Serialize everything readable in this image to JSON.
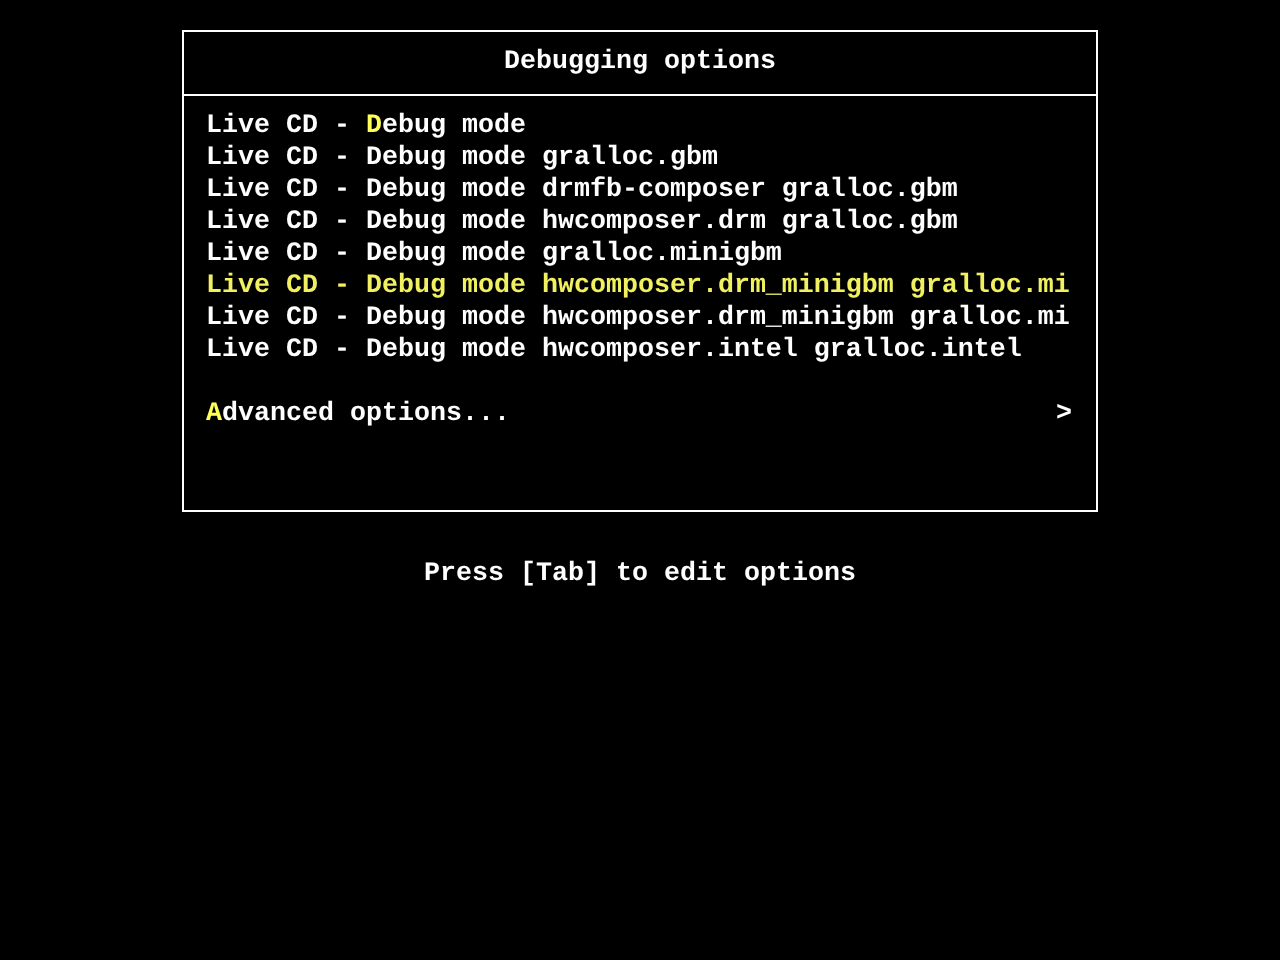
{
  "menu": {
    "title": "Debugging options",
    "items": [
      {
        "kind": "entry",
        "selected": false,
        "segments": [
          {
            "text": "Live CD - ",
            "hotkey": false
          },
          {
            "text": "D",
            "hotkey": true
          },
          {
            "text": "ebug mode",
            "hotkey": false
          }
        ]
      },
      {
        "kind": "entry",
        "selected": false,
        "segments": [
          {
            "text": "Live CD - Debug mode gralloc.gbm",
            "hotkey": false
          }
        ]
      },
      {
        "kind": "entry",
        "selected": false,
        "segments": [
          {
            "text": "Live CD - Debug mode drmfb-composer gralloc.gbm",
            "hotkey": false
          }
        ]
      },
      {
        "kind": "entry",
        "selected": false,
        "segments": [
          {
            "text": "Live CD - Debug mode hwcomposer.drm gralloc.gbm",
            "hotkey": false
          }
        ]
      },
      {
        "kind": "entry",
        "selected": false,
        "segments": [
          {
            "text": "Live CD - Debug mode gralloc.minigbm",
            "hotkey": false
          }
        ]
      },
      {
        "kind": "entry",
        "selected": true,
        "segments": [
          {
            "text": "Live CD - Debug mode hwcomposer.drm_minigbm gralloc.mi",
            "hotkey": false
          }
        ]
      },
      {
        "kind": "entry",
        "selected": false,
        "segments": [
          {
            "text": "Live CD - Debug mode hwcomposer.drm_minigbm gralloc.mi",
            "hotkey": false
          }
        ]
      },
      {
        "kind": "entry",
        "selected": false,
        "segments": [
          {
            "text": "Live CD - Debug mode hwcomposer.intel gralloc.intel",
            "hotkey": false
          }
        ]
      },
      {
        "kind": "submenu",
        "selected": false,
        "arrow": ">",
        "segments": [
          {
            "text": "A",
            "hotkey": true
          },
          {
            "text": "dvanced options...",
            "hotkey": false
          }
        ]
      }
    ]
  },
  "hint": "Press [Tab] to edit options"
}
